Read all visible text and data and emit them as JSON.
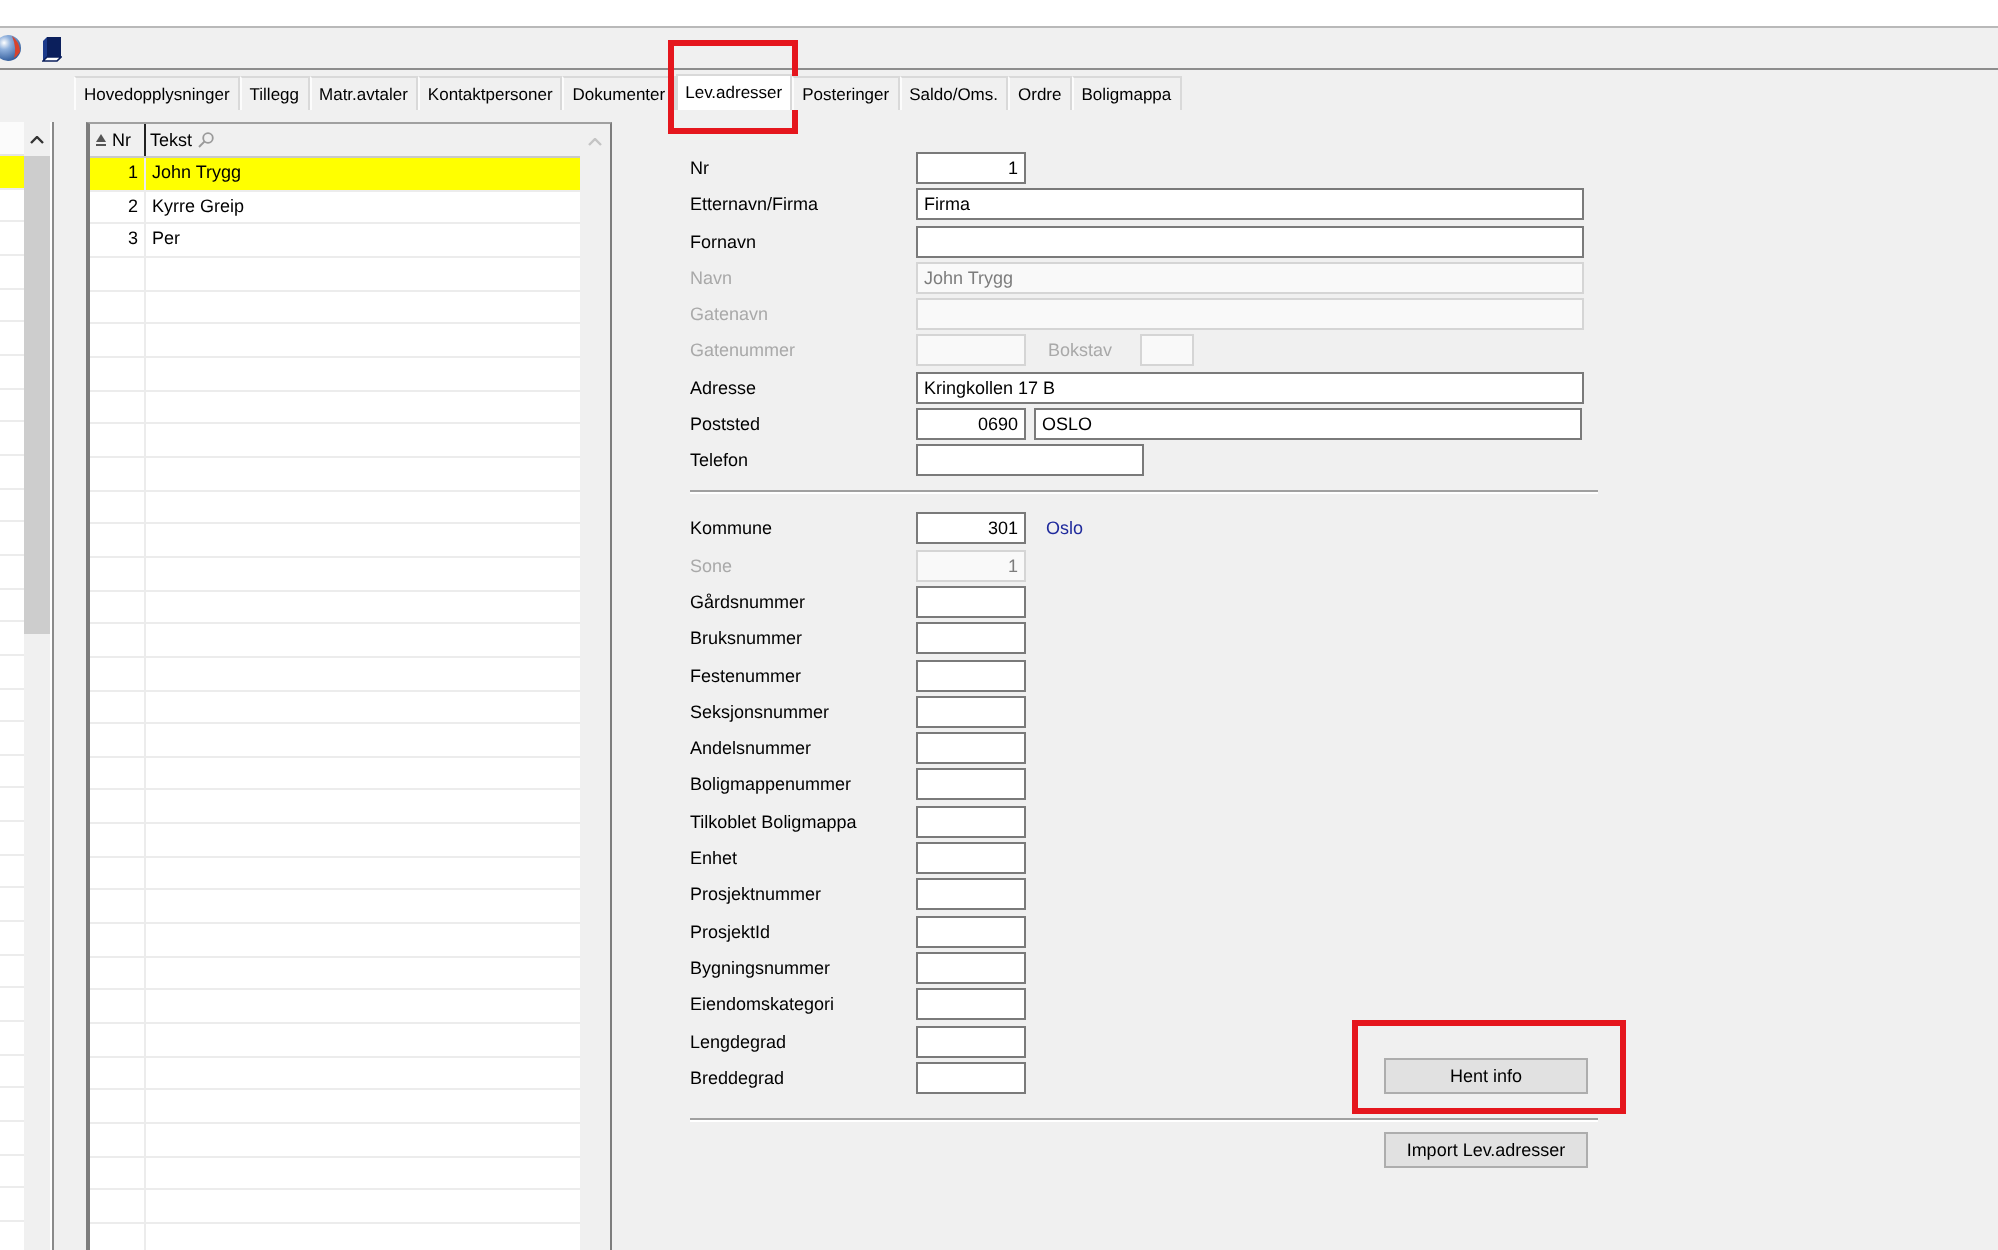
{
  "tabs": [
    {
      "label": "Hovedopplysninger",
      "selected": false,
      "highlighted": false
    },
    {
      "label": "Tillegg",
      "selected": false,
      "highlighted": false
    },
    {
      "label": "Matr.avtaler",
      "selected": false,
      "highlighted": false
    },
    {
      "label": "Kontaktpersoner",
      "selected": false,
      "highlighted": false
    },
    {
      "label": "Dokumenter",
      "selected": false,
      "highlighted": false
    },
    {
      "label": "Lev.adresser",
      "selected": true,
      "highlighted": true
    },
    {
      "label": "Posteringer",
      "selected": false,
      "highlighted": false
    },
    {
      "label": "Saldo/Oms.",
      "selected": false,
      "highlighted": false
    },
    {
      "label": "Ordre",
      "selected": false,
      "highlighted": false
    },
    {
      "label": "Boligmappa",
      "selected": false,
      "highlighted": false
    }
  ],
  "left_list": {
    "rows": [
      {
        "selected": true
      }
    ]
  },
  "list": {
    "columns": [
      {
        "label": "Nr",
        "sorted": true,
        "searchable": false
      },
      {
        "label": "Tekst",
        "sorted": false,
        "searchable": true
      }
    ],
    "rows": [
      {
        "nr": "1",
        "text": "John Trygg",
        "selected": true
      },
      {
        "nr": "2",
        "text": "Kyrre Greip",
        "selected": false
      },
      {
        "nr": "3",
        "text": "Per",
        "selected": false
      }
    ]
  },
  "form": {
    "sections": [
      {
        "rows": [
          {
            "label": "Nr",
            "kind": "number",
            "disabled": false,
            "value": "1"
          },
          {
            "label": "Etternavn/Firma",
            "kind": "text",
            "disabled": false,
            "value": "Firma"
          },
          {
            "label": "Fornavn",
            "kind": "text",
            "disabled": false
          },
          {
            "label": "Navn",
            "kind": "text",
            "disabled": true,
            "value": "John Trygg"
          },
          {
            "label": "Gatenavn",
            "kind": "text",
            "disabled": true
          },
          {
            "label": "Gatenummer",
            "kind": "street-number",
            "disabled": true,
            "letter_label": "Bokstav"
          },
          {
            "label": "Adresse",
            "kind": "text",
            "disabled": false,
            "value": "Kringkollen 17 B"
          },
          {
            "label": "Poststed",
            "kind": "postal",
            "disabled": false,
            "value": "0690",
            "place": "OSLO"
          },
          {
            "label": "Telefon",
            "kind": "phone",
            "disabled": false
          }
        ]
      },
      {
        "rows": [
          {
            "label": "Kommune",
            "kind": "municipality",
            "disabled": false,
            "value": "301",
            "link": "Oslo"
          },
          {
            "label": "Sone",
            "kind": "number",
            "disabled": true,
            "value": "1"
          },
          {
            "label": "Gårdsnummer",
            "kind": "number",
            "disabled": false
          },
          {
            "label": "Bruksnummer",
            "kind": "number",
            "disabled": false
          },
          {
            "label": "Festenummer",
            "kind": "number",
            "disabled": false
          },
          {
            "label": "Seksjonsnummer",
            "kind": "number",
            "disabled": false
          },
          {
            "label": "Andelsnummer",
            "kind": "number",
            "disabled": false
          },
          {
            "label": "Boligmappenummer",
            "kind": "number",
            "disabled": false
          },
          {
            "label": "Tilkoblet Boligmappa",
            "kind": "number",
            "disabled": false
          },
          {
            "label": "Enhet",
            "kind": "number",
            "disabled": false
          },
          {
            "label": "Prosjektnummer",
            "kind": "number",
            "disabled": false
          },
          {
            "label": "ProsjektId",
            "kind": "number",
            "disabled": false
          },
          {
            "label": "Bygningsnummer",
            "kind": "number",
            "disabled": false
          },
          {
            "label": "Eiendomskategori",
            "kind": "number",
            "disabled": false
          },
          {
            "label": "Lengdegrad",
            "kind": "number",
            "disabled": false
          },
          {
            "label": "Breddegrad",
            "kind": "number",
            "disabled": false
          }
        ],
        "button": {
          "label": "Hent info",
          "highlighted": true
        }
      }
    ],
    "footer_button": {
      "label": "Import Lev.adresser"
    }
  }
}
